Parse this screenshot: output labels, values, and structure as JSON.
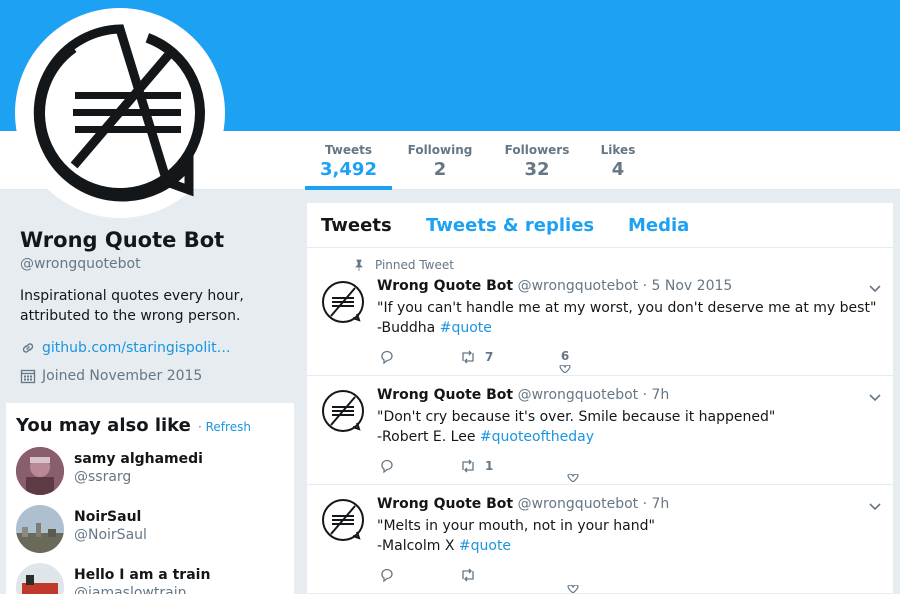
{
  "profile": {
    "name": "Wrong Quote Bot",
    "handle": "@wrongquotebot",
    "bio_line1": "Inspirational quotes every hour,",
    "bio_line2": "attributed to the wrong person.",
    "url": "github.com/staringispolit…",
    "joined": "Joined November 2015"
  },
  "stats": [
    {
      "label": "Tweets",
      "value": "3,492"
    },
    {
      "label": "Following",
      "value": "2"
    },
    {
      "label": "Followers",
      "value": "32"
    },
    {
      "label": "Likes",
      "value": "4"
    }
  ],
  "timeline_tabs": [
    "Tweets",
    "Tweets & replies",
    "Media"
  ],
  "who_to_follow": {
    "title": "You may also like",
    "refresh": "· Refresh",
    "users": [
      {
        "name": "samy alghamedi",
        "handle": "@ssrarg"
      },
      {
        "name": "NoirSaul",
        "handle": "@NoirSaul"
      },
      {
        "name": "Hello I am a train",
        "handle": "@iamaslowtrain"
      }
    ]
  },
  "tweets": [
    {
      "pinned_label": "Pinned Tweet",
      "name": "Wrong Quote Bot",
      "handle": "@wrongquotebot",
      "date": "· 5 Nov 2015",
      "quote": "\"If you can't handle me at my worst, you don't deserve me at my best\"",
      "author": "-Buddha",
      "hashtag": "#quote",
      "retweets": "7",
      "likes": "6"
    },
    {
      "name": "Wrong Quote Bot",
      "handle": "@wrongquotebot",
      "date": "· 7h",
      "quote": "\"Don't cry because it's over. Smile because it happened\"",
      "author": "-Robert E. Lee",
      "hashtag": "#quoteoftheday",
      "retweets": "1",
      "likes": ""
    },
    {
      "name": "Wrong Quote Bot",
      "handle": "@wrongquotebot",
      "date": "· 7h",
      "quote": "\"Melts in your mouth, not in your hand\"",
      "author": "-Malcolm X",
      "hashtag": "#quote",
      "retweets": "",
      "likes": ""
    }
  ],
  "icons": {
    "avatar": "no-equal-speech-bubble-logo",
    "pin": "pin-icon",
    "link": "link-icon",
    "calendar": "calendar-icon",
    "reply": "reply-icon",
    "retweet": "retweet-icon",
    "like": "heart-icon",
    "caret": "chevron-down-icon"
  },
  "colors": {
    "accent": "#1da1f2",
    "link": "#1b95e0",
    "muted": "#657786",
    "background": "#e6ecf0"
  }
}
